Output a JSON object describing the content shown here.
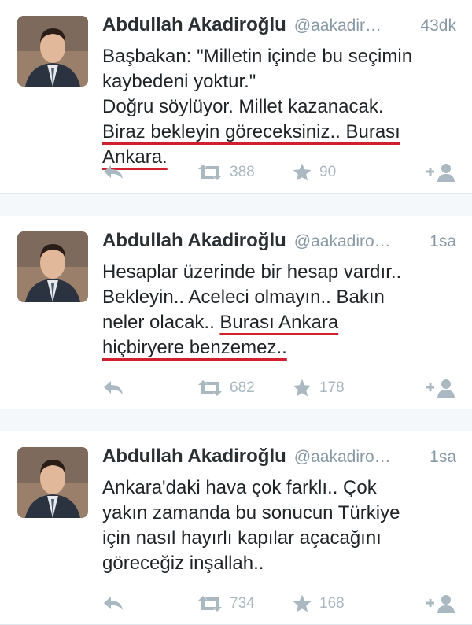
{
  "tweets": [
    {
      "name": "Abdullah Akadiroğlu",
      "handle": "@aakadir…",
      "time": "43dk",
      "lines": [
        [
          {
            "t": "Başbakan: \"Milletin içinde bu seçimin"
          }
        ],
        [
          {
            "t": "kaybedeni yoktur.\""
          }
        ],
        [
          {
            "t": "Doğru söylüyor. Millet kazanacak."
          }
        ],
        [
          {
            "t": "Biraz bekleyin göreceksiniz.. Burası",
            "u": true
          }
        ],
        [
          {
            "t": "Ankara.",
            "u": true
          }
        ]
      ],
      "retweets": "388",
      "favorites": "90"
    },
    {
      "name": "Abdullah Akadiroğlu",
      "handle": "@aakadiro…",
      "time": "1sa",
      "lines": [
        [
          {
            "t": "Hesaplar üzerinde bir hesap vardır.."
          }
        ],
        [
          {
            "t": "Bekleyin.. Aceleci olmayın.. Bakın"
          }
        ],
        [
          {
            "t": "neler olacak.. "
          },
          {
            "t": "Burası Ankara",
            "u": true
          }
        ],
        [
          {
            "t": "hiçbiryere benzemez..",
            "u": true
          }
        ]
      ],
      "retweets": "682",
      "favorites": "178"
    },
    {
      "name": "Abdullah Akadiroğlu",
      "handle": "@aakadiro…",
      "time": "1sa",
      "lines": [
        [
          {
            "t": "Ankara'daki hava çok farklı.. Çok"
          }
        ],
        [
          {
            "t": "yakın zamanda bu sonucun Türkiye"
          }
        ],
        [
          {
            "t": "için nasıl hayırlı kapılar açacağını"
          }
        ],
        [
          {
            "t": "göreceğiz inşallah.."
          }
        ]
      ],
      "retweets": "734",
      "favorites": "168"
    }
  ],
  "icons": {
    "reply": "reply-icon",
    "retweet": "retweet-icon",
    "favorite": "star-icon",
    "follow": "add-user-icon"
  },
  "colors": {
    "icon": "#aab8c2",
    "underline": "#d0202e",
    "handle": "#8899a6",
    "divider": "#e1e8ed"
  }
}
